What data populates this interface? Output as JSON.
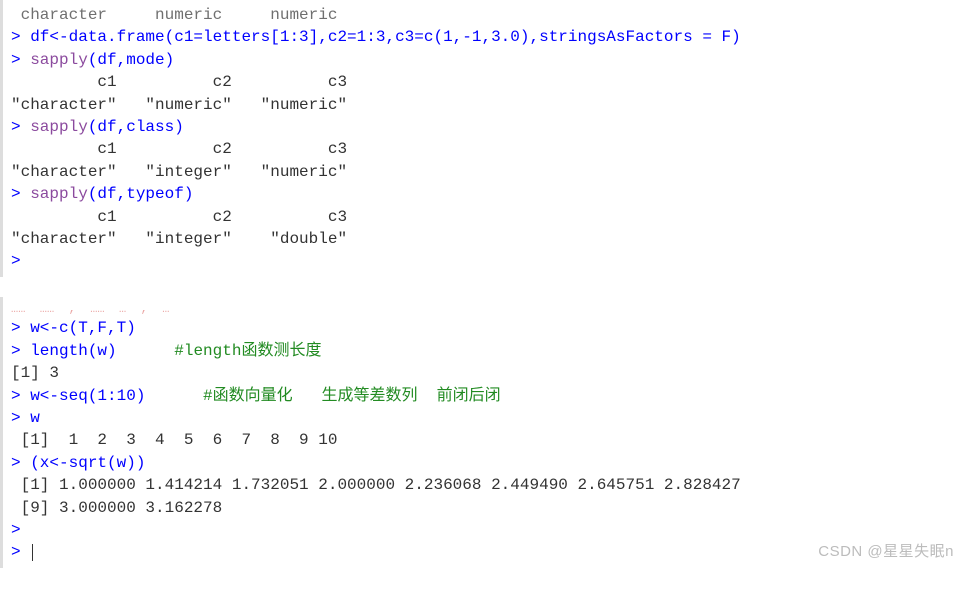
{
  "block1": {
    "cutline": " character     numeric     numeric ",
    "lines": [
      {
        "type": "in",
        "segments": [
          {
            "cls": "prompt",
            "t": "> "
          },
          {
            "cls": "input",
            "t": "df<-data.frame(c1=letters[1:3],c2=1:3,c3=c(1,-1,3.0),stringsAsFactors = F)"
          }
        ]
      },
      {
        "type": "in",
        "segments": [
          {
            "cls": "prompt",
            "t": "> "
          },
          {
            "cls": "func",
            "t": "sapply"
          },
          {
            "cls": "input",
            "t": "(df,mode)"
          }
        ]
      },
      {
        "type": "out",
        "text": "         c1          c2          c3 "
      },
      {
        "type": "out",
        "text": "\"character\"   \"numeric\"   \"numeric\" "
      },
      {
        "type": "in",
        "segments": [
          {
            "cls": "prompt",
            "t": "> "
          },
          {
            "cls": "func",
            "t": "sapply"
          },
          {
            "cls": "input",
            "t": "(df,class)"
          }
        ]
      },
      {
        "type": "out",
        "text": "         c1          c2          c3 "
      },
      {
        "type": "out",
        "text": "\"character\"   \"integer\"   \"numeric\" "
      },
      {
        "type": "in",
        "segments": [
          {
            "cls": "prompt",
            "t": "> "
          },
          {
            "cls": "func",
            "t": "sapply"
          },
          {
            "cls": "input",
            "t": "(df,typeof)"
          }
        ]
      },
      {
        "type": "out",
        "text": "         c1          c2          c3 "
      },
      {
        "type": "out",
        "text": "\"character\"   \"integer\"    \"double\" "
      },
      {
        "type": "in",
        "segments": [
          {
            "cls": "prompt",
            "t": "> "
          }
        ]
      }
    ]
  },
  "block2": {
    "redline": "……  ……  ,  ……  …  ,  …",
    "lines": [
      {
        "type": "in",
        "segments": [
          {
            "cls": "prompt",
            "t": "> "
          },
          {
            "cls": "input",
            "t": "w<-c(T,F,T)"
          }
        ]
      },
      {
        "type": "in",
        "segments": [
          {
            "cls": "prompt",
            "t": "> "
          },
          {
            "cls": "input",
            "t": "length(w)      "
          },
          {
            "cls": "comment",
            "t": "#length函数测长度"
          }
        ]
      },
      {
        "type": "out",
        "text": "[1] 3"
      },
      {
        "type": "in",
        "segments": [
          {
            "cls": "prompt",
            "t": "> "
          },
          {
            "cls": "input",
            "t": "w<-seq(1:10)      "
          },
          {
            "cls": "comment",
            "t": "#函数向量化   生成等差数列  前闭后闭"
          }
        ]
      },
      {
        "type": "in",
        "segments": [
          {
            "cls": "prompt",
            "t": "> "
          },
          {
            "cls": "input",
            "t": "w"
          }
        ]
      },
      {
        "type": "out",
        "text": " [1]  1  2  3  4  5  6  7  8  9 10"
      },
      {
        "type": "in",
        "segments": [
          {
            "cls": "prompt",
            "t": "> "
          },
          {
            "cls": "input",
            "t": "(x<-sqrt(w))"
          }
        ]
      },
      {
        "type": "out",
        "text": " [1] 1.000000 1.414214 1.732051 2.000000 2.236068 2.449490 2.645751 2.828427"
      },
      {
        "type": "out",
        "text": " [9] 3.000000 3.162278"
      },
      {
        "type": "in",
        "segments": [
          {
            "cls": "prompt",
            "t": "> "
          }
        ]
      },
      {
        "type": "cursor",
        "segments": [
          {
            "cls": "prompt",
            "t": "> "
          }
        ]
      }
    ]
  },
  "watermark": "CSDN @星星失眠n"
}
